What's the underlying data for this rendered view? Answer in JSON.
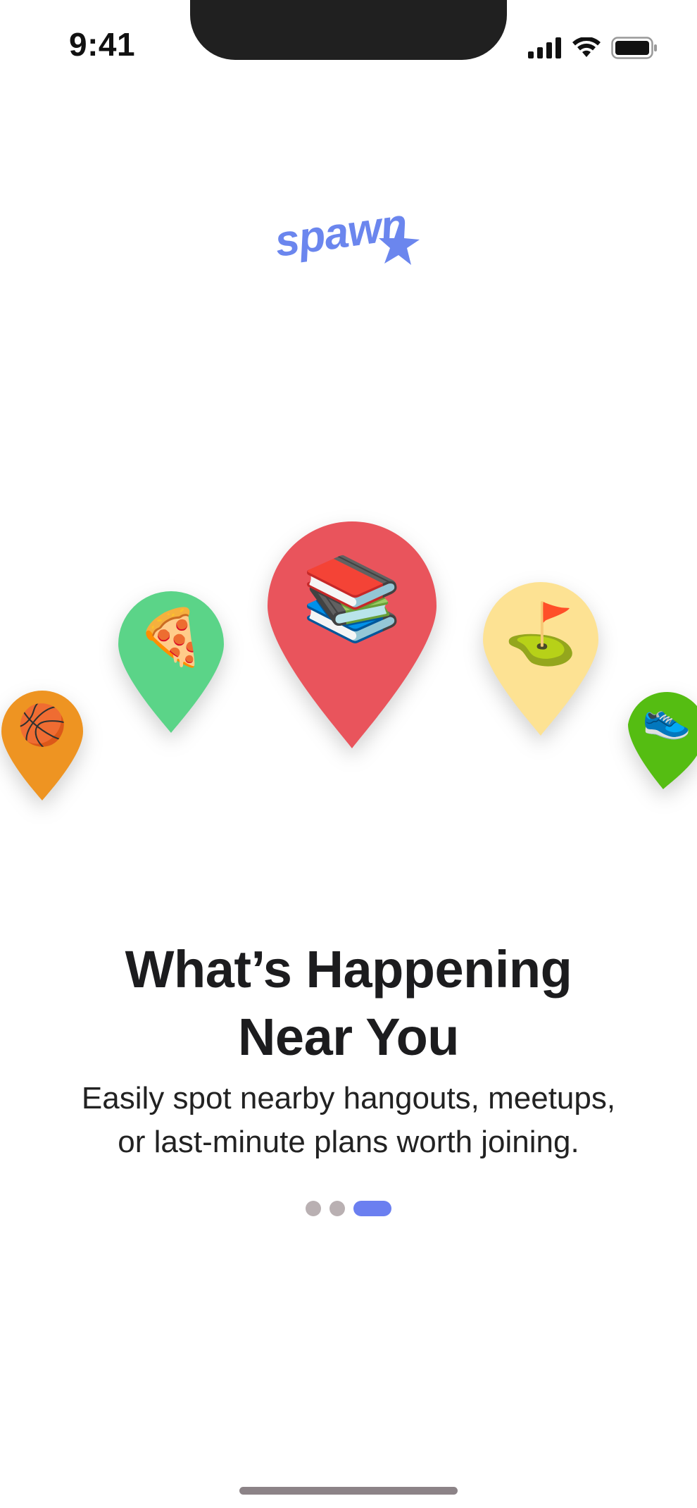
{
  "status_bar": {
    "time": "9:41"
  },
  "logo": {
    "text": "spawn",
    "color": "#6b86ee"
  },
  "pins": [
    {
      "name": "basketball",
      "emoji": "🏀",
      "color": "#ee9422"
    },
    {
      "name": "pizza",
      "emoji": "🍕",
      "color": "#5bd488"
    },
    {
      "name": "books",
      "emoji": "📚",
      "color": "#e9545c"
    },
    {
      "name": "golf",
      "emoji": "⛳",
      "color": "#fde293"
    },
    {
      "name": "sneaker",
      "emoji": "👟",
      "color": "#55bd12"
    }
  ],
  "onboarding": {
    "title_line1": "What’s Happening",
    "title_line2": "Near You",
    "subtitle_line1": "Easily spot nearby hangouts, meetups,",
    "subtitle_line2": "or last-minute plans worth joining."
  },
  "pagination": {
    "total_pages": 3,
    "current_page": 3,
    "active_color": "#6b7ff0",
    "inactive_color": "#b9b0b2"
  }
}
